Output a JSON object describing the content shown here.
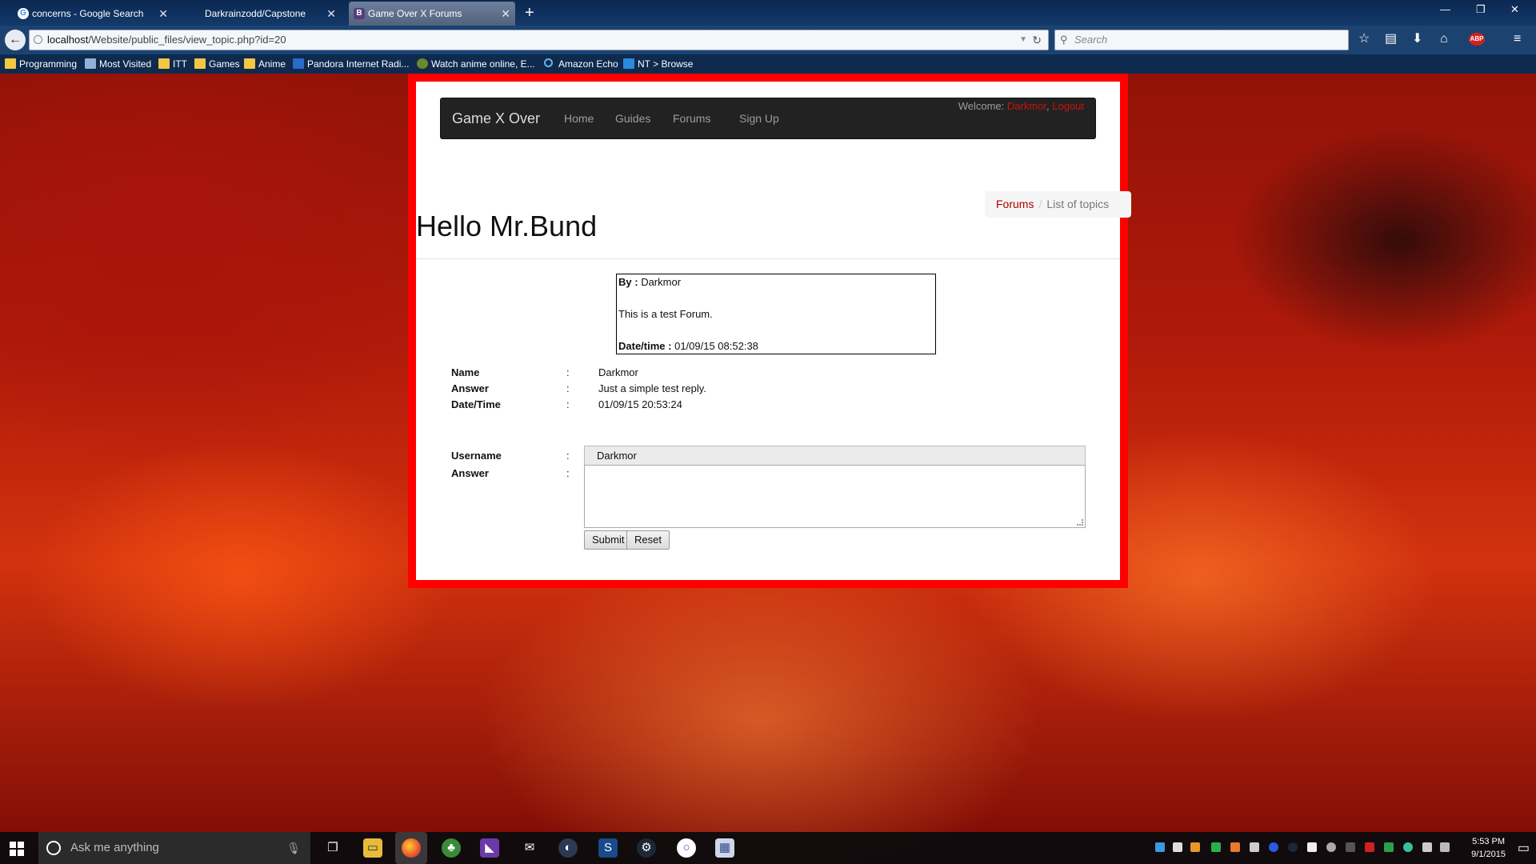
{
  "browser": {
    "tabs": [
      {
        "label": "concerns - Google Search",
        "icon": "google-icon"
      },
      {
        "label": "Darkrainzodd/Capstone",
        "icon": "github-icon"
      },
      {
        "label": "Game Over X Forums",
        "icon": "bootstrap-icon"
      }
    ],
    "url_host": "localhost",
    "url_path": "/Website/public_files/view_topic.php?id=20",
    "search_placeholder": "Search",
    "bookmarks": [
      "Programming",
      "Most Visited",
      "ITT",
      "Games",
      "Anime",
      "Pandora Internet Radi...",
      "Watch anime online, E...",
      "Amazon Echo",
      "NT > Browse"
    ]
  },
  "site": {
    "brand": "Game X Over",
    "nav": [
      "Home",
      "Guides",
      "Forums",
      "Sign Up"
    ],
    "welcome_prefix": "Welcome: ",
    "welcome_user": "Darkmor",
    "logout": "Logout",
    "breadcrumb": {
      "link": "Forums",
      "sep": "/",
      "active": "List of topics"
    }
  },
  "topic": {
    "title": "Hello Mr.Bund",
    "by_label": "By :",
    "by_value": "Darkmor",
    "body": "This is a test Forum.",
    "date_label": "Date/time :",
    "date_value": "01/09/15 08:52:38"
  },
  "reply": {
    "name_label": "Name",
    "name_value": "Darkmor",
    "answer_label": "Answer",
    "answer_value": "Just a simple test reply.",
    "datetime_label": "Date/Time",
    "datetime_value": "01/09/15 20:53:24",
    "colon": ":"
  },
  "form": {
    "username_label": "Username",
    "username_value": "Darkmor",
    "answer_label": "Answer",
    "answer_value": "",
    "submit_label": "Submit",
    "reset_label": "Reset"
  },
  "taskbar": {
    "search_placeholder": "Ask me anything",
    "time": "5:53 PM",
    "date": "9/1/2015"
  }
}
